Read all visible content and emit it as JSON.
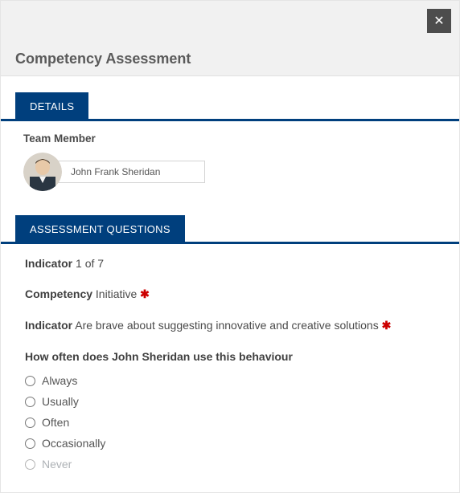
{
  "modal": {
    "title": "Competency Assessment",
    "close_glyph": "✕"
  },
  "details": {
    "tab_label": "DETAILS",
    "team_member_label": "Team Member",
    "member_name": "John Frank Sheridan"
  },
  "assessment": {
    "tab_label": "ASSESSMENT QUESTIONS",
    "indicator_count_label": "Indicator",
    "indicator_count_value": "1 of 7",
    "competency_label": "Competency",
    "competency_value": "Initiative",
    "indicator_label": "Indicator",
    "indicator_value": "Are brave about suggesting innovative and creative solutions",
    "required_glyph": "✱",
    "question_text": "How often does John Sheridan use this behaviour",
    "options": [
      "Always",
      "Usually",
      "Often",
      "Occasionally",
      "Never"
    ]
  }
}
